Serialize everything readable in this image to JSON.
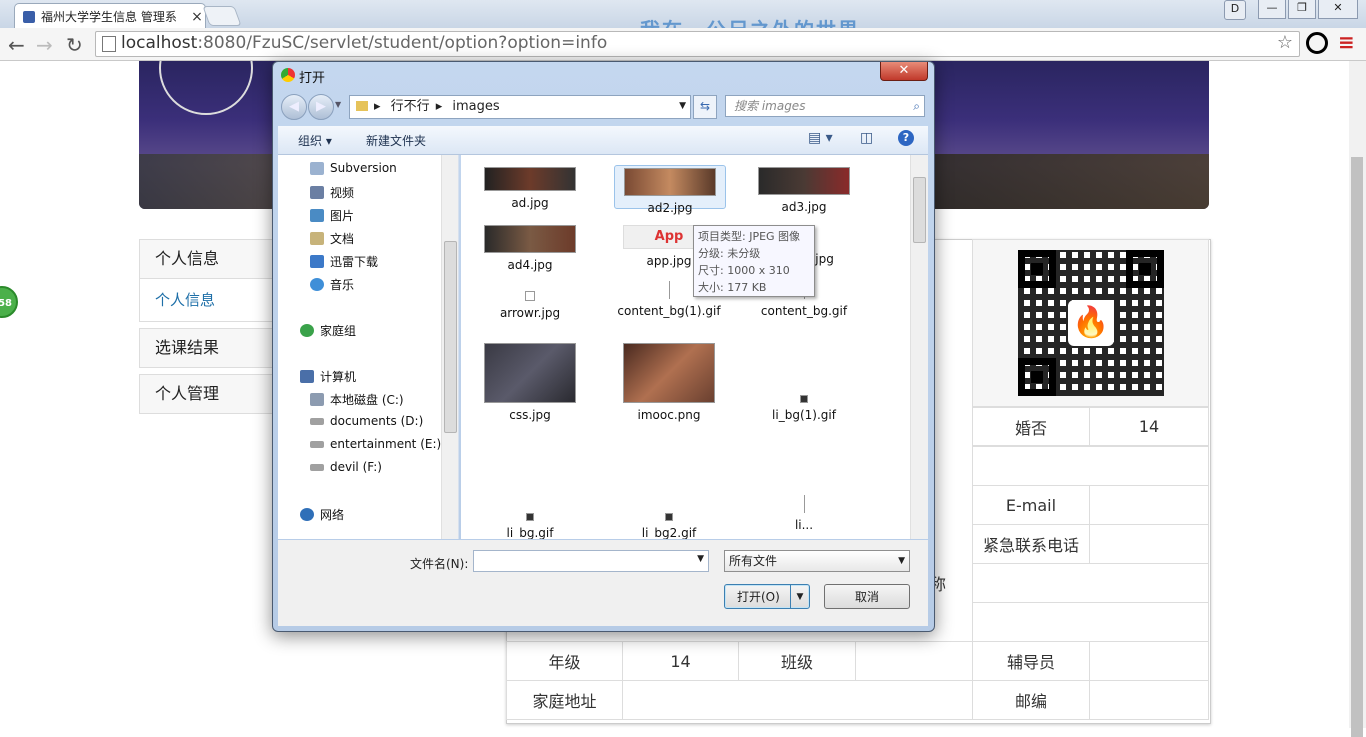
{
  "browser": {
    "tab_title": "福州大学学生信息 管理系",
    "tab_close": "×",
    "watermark": "我在一公尺之外的世界",
    "url_host": "localhost",
    "url_rest": ":8080/FzuSC/servlet/student/option?option=info",
    "window_buttons": [
      "D",
      "—",
      "❐",
      "✕"
    ]
  },
  "page": {
    "float_badge": "58",
    "sidenav": [
      {
        "label": "个人信息",
        "sub": "个人信息"
      },
      {
        "label": "选课结果"
      },
      {
        "label": "个人管理"
      }
    ],
    "table_cells": {
      "marital": "婚否",
      "marital_value": "14",
      "email": "E-mail",
      "emergency": "紧急联系电话",
      "nickname_tail": "称",
      "grade": "年级",
      "grade_value": "14",
      "class": "班级",
      "counselor": "辅导员",
      "address": "家庭地址",
      "zipcode": "邮编"
    }
  },
  "dialog": {
    "title": "打开",
    "close": "✕",
    "breadcrumb": [
      "行不行",
      "images"
    ],
    "search_placeholder": "搜索 images",
    "organize": "组织 ▾",
    "new_folder": "新建文件夹",
    "help": "?",
    "nav_items": [
      {
        "label": "Subversion",
        "icon": "svn-icon",
        "color": "#9bb2d0"
      },
      {
        "label": "视频",
        "icon": "video-library-icon",
        "color": "#6b7fa3"
      },
      {
        "label": "图片",
        "icon": "pictures-library-icon",
        "color": "#4a8bc4"
      },
      {
        "label": "文档",
        "icon": "documents-library-icon",
        "color": "#c7b37a"
      },
      {
        "label": "迅雷下载",
        "icon": "download-folder-icon",
        "color": "#3c79c8"
      },
      {
        "label": "音乐",
        "icon": "music-library-icon",
        "color": "#3f8fd8"
      },
      {
        "label": "家庭组",
        "icon": "homegroup-icon",
        "color": "#3aa24a"
      },
      {
        "label": "计算机",
        "icon": "computer-icon",
        "color": "#4a6fa8"
      },
      {
        "label": "本地磁盘 (C:)",
        "icon": "drive-c-icon",
        "color": "#8c9bb0"
      },
      {
        "label": "documents (D:)",
        "icon": "drive-icon",
        "color": "#a0a0a0"
      },
      {
        "label": "entertainment (E:)",
        "icon": "drive-icon",
        "color": "#a0a0a0"
      },
      {
        "label": "devil (F:)",
        "icon": "drive-icon",
        "color": "#a0a0a0"
      },
      {
        "label": "网络",
        "icon": "network-icon",
        "color": "#2f6fb8"
      }
    ],
    "files": [
      {
        "name": "ad.jpg"
      },
      {
        "name": "ad2.jpg"
      },
      {
        "name": "ad3.jpg"
      },
      {
        "name": "ad4.jpg"
      },
      {
        "name": "app.jpg"
      },
      {
        "name": "arrowl.jpg"
      },
      {
        "name": "arrowr.jpg"
      },
      {
        "name": "content_bg(1).gif"
      },
      {
        "name": "content_bg.gif"
      },
      {
        "name": "css.jpg"
      },
      {
        "name": "imooc.png"
      },
      {
        "name": "li_bg(1).gif"
      },
      {
        "name": "li_bg.gif"
      },
      {
        "name": "li_bg2.gif"
      },
      {
        "name": "li..."
      }
    ],
    "tooltip": {
      "type": "项目类型: JPEG 图像",
      "rating": "分级: 未分级",
      "size_dim": "尺寸: 1000 x 310",
      "size": "大小: 177 KB"
    },
    "filename_label": "文件名(N):",
    "filename_value": "",
    "filter_value": "所有文件",
    "open_button": "打开(O)",
    "cancel_button": "取消"
  }
}
